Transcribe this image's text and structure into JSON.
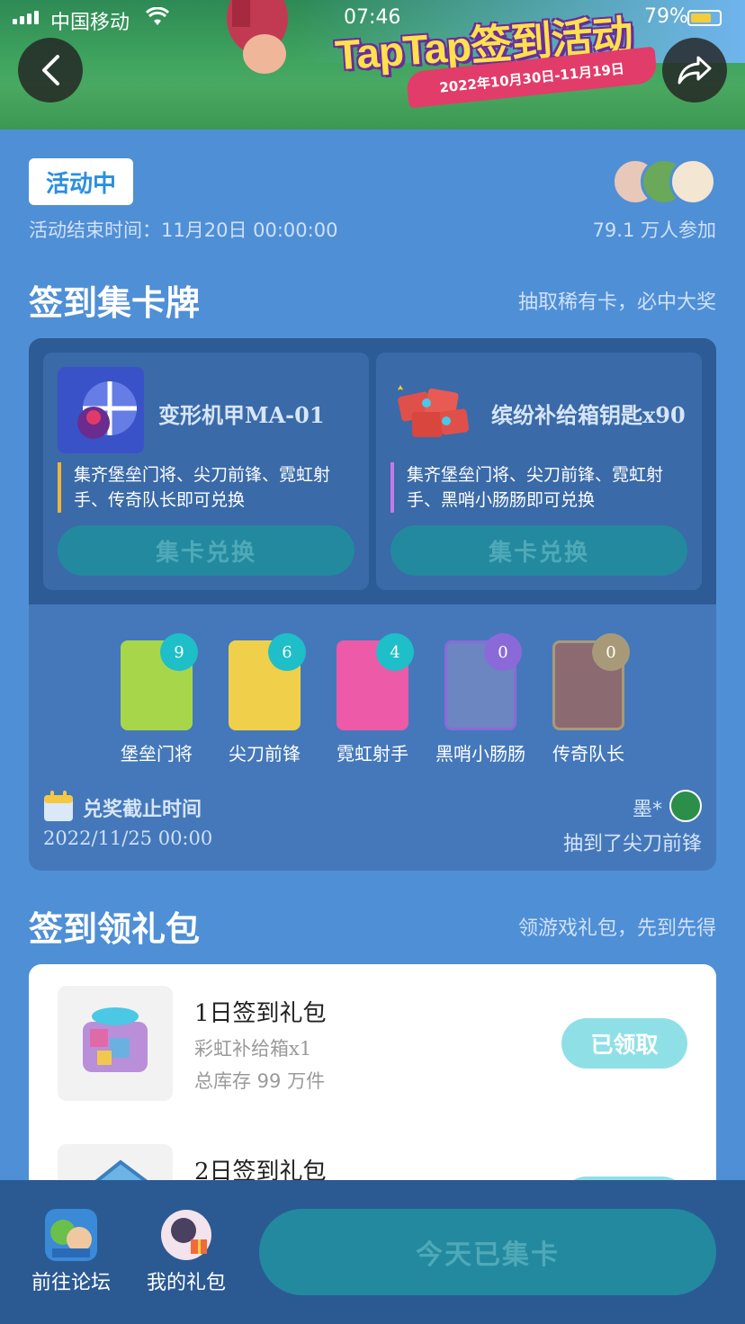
{
  "status_bar": {
    "carrier": "中国移动",
    "time": "07:46",
    "battery": "79%"
  },
  "banner": {
    "title": "TapTap签到活动",
    "date_range": "2022年10月30日-11月19日"
  },
  "activity": {
    "status_badge": "活动中",
    "end_time": "活动结束时间：11月20日 00:00:00",
    "participants": "79.1 万人参加"
  },
  "collect_section": {
    "title": "签到集卡牌",
    "subtitle": "抽取稀有卡，必中大奖",
    "rewards": [
      {
        "name": "变形机甲MA-01",
        "desc": "集齐堡垒门将、尖刀前锋、霓虹射手、传奇队长即可兑换",
        "button": "集卡兑换",
        "accent": "#f0b43a"
      },
      {
        "name": "缤纷补给箱钥匙x90",
        "desc": "集齐堡垒门将、尖刀前锋、霓虹射手、黑哨小肠肠即可兑换",
        "button": "集卡兑换",
        "accent": "#c77ae6"
      }
    ],
    "characters": [
      {
        "name": "堡垒门将",
        "count": "9",
        "tile_color": "#a8d64a",
        "badge_color": "#1ebfc8"
      },
      {
        "name": "尖刀前锋",
        "count": "6",
        "tile_color": "#f0d04a",
        "badge_color": "#1ebfc8"
      },
      {
        "name": "霓虹射手",
        "count": "4",
        "tile_color": "#ec5aa8",
        "badge_color": "#1ebfc8"
      },
      {
        "name": "黑哨小肠肠",
        "count": "0",
        "tile_color": "#6c86c2",
        "badge_color": "#8a6ad8"
      },
      {
        "name": "传奇队长",
        "count": "0",
        "tile_color": "#8b6a72",
        "badge_color": "#a89a78"
      }
    ],
    "deadline_label": "兑奖截止时间",
    "deadline_time": "2022/11/25 00:00",
    "winner_name": "墨*",
    "winner_note": "抽到了尖刀前锋"
  },
  "gift_section": {
    "title": "签到领礼包",
    "subtitle": "领游戏礼包，先到先得",
    "items": [
      {
        "title": "1日签到礼包",
        "sub": "彩虹补给箱x1",
        "stock": "总库存 99 万件",
        "button": "已领取"
      },
      {
        "title": "2日签到礼包",
        "sub": "",
        "stock": "",
        "button": ""
      }
    ]
  },
  "bottom_bar": {
    "forum_label": "前往论坛",
    "gifts_label": "我的礼包",
    "main_button": "今天已集卡"
  }
}
